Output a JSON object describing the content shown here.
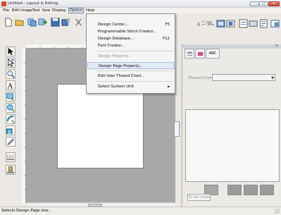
{
  "window": {
    "title": "Untitled - Layout & Editing",
    "controls": {
      "min": "–",
      "max": "□",
      "close": "✕"
    }
  },
  "menubar": {
    "items": [
      "File",
      "Edit",
      "Image",
      "Text",
      "Sew",
      "Display",
      "Option",
      "Help"
    ],
    "open_item": "Option"
  },
  "option_menu": {
    "items": [
      {
        "label": "Design Center...",
        "shortcut": "F5"
      },
      {
        "label": "Programmable Stitch Creator...",
        "shortcut": ""
      },
      {
        "label": "Design Database...",
        "shortcut": "F12"
      },
      {
        "label": "Font Creator...",
        "shortcut": ""
      },
      {
        "label": "Design Property...",
        "shortcut": "",
        "disabled": true
      },
      {
        "label": "Design Page Property...",
        "shortcut": "",
        "highlighted": true
      },
      {
        "label": "Edit User Thread Chart...",
        "shortcut": ""
      },
      {
        "label": "Select System Unit",
        "shortcut": "",
        "submenu": true
      }
    ]
  },
  "side_panel": {
    "close": "×",
    "tabs": [
      "",
      "",
      "ABC"
    ],
    "thread_chart_label": "Thread Chart",
    "to_list_mode": "To list mode"
  },
  "statusbar": {
    "text": "Selects Design Page size."
  },
  "scroll": {
    "thumb": "==="
  },
  "colors": {
    "accent": "#5b8dc9",
    "canvas": "#a8a8a8",
    "page": "#ffffff"
  }
}
